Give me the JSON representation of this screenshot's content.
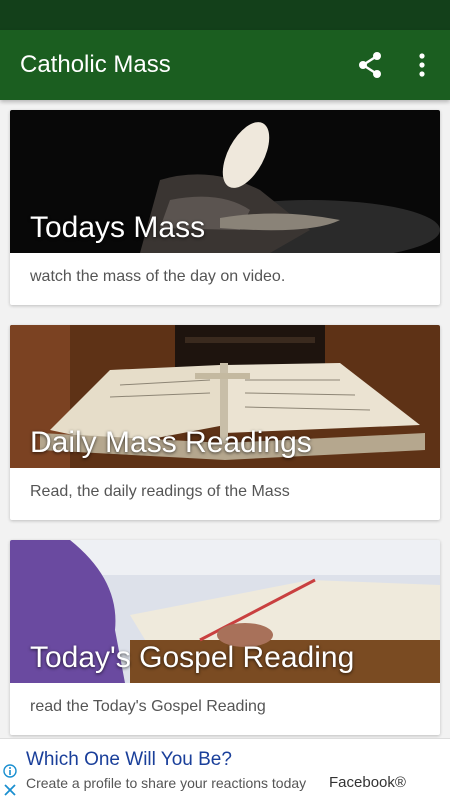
{
  "app": {
    "title": "Catholic Mass",
    "primary_color": "#1b5e20",
    "status_bar_color": "#13401a"
  },
  "toolbar": {
    "share_icon": "share-icon",
    "more_icon": "more-vert-icon"
  },
  "cards": [
    {
      "title": "Todays Mass",
      "description": "watch the mass of the day on video."
    },
    {
      "title": "Daily Mass Readings",
      "description": "Read, the daily readings of the Mass"
    },
    {
      "title": "Today's Gospel Reading",
      "description": "read the Today's Gospel Reading"
    }
  ],
  "ad": {
    "headline": "Which One Will You Be?",
    "body": "Create a profile to share your reactions today",
    "advertiser": "Facebook®",
    "info_icon": "ad-info-icon",
    "close_icon": "ad-close-icon"
  }
}
